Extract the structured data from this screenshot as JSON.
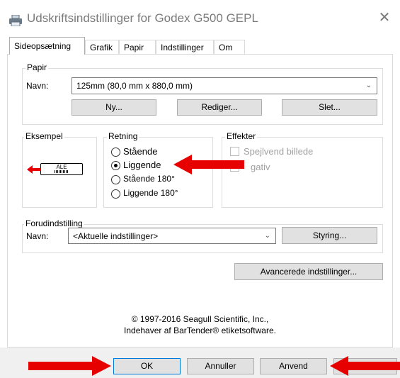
{
  "window": {
    "title": "Udskriftsindstillinger for Godex G500 GEPL",
    "close_symbol": "✕",
    "icon": "printer-icon"
  },
  "tabs": [
    {
      "label": "Sideopsætning",
      "active": true
    },
    {
      "label": "Grafik",
      "active": false
    },
    {
      "label": "Papir",
      "active": false
    },
    {
      "label": "Indstillinger",
      "active": false
    },
    {
      "label": "Om",
      "active": false
    }
  ],
  "papir": {
    "legend": "Papir",
    "name_label": "Navn:",
    "name_value": "125mm (80,0 mm x 880,0 mm)",
    "buttons": {
      "new": "Ny...",
      "edit": "Rediger...",
      "delete": "Slet..."
    }
  },
  "eksempel": {
    "legend": "Eksempel",
    "preview_text": "ALE"
  },
  "retning": {
    "legend": "Retning",
    "options": [
      {
        "label": "Stående",
        "selected": false
      },
      {
        "label": "Liggende",
        "selected": true
      },
      {
        "label": "Stående 180°",
        "selected": false
      },
      {
        "label": "Liggende 180°",
        "selected": false
      }
    ]
  },
  "effekter": {
    "legend": "Effekter",
    "options": [
      {
        "label": "Spejlvend billede",
        "checked": false,
        "enabled": false
      },
      {
        "label": "Negativ",
        "checked": false,
        "enabled": false
      }
    ],
    "visible_negativ_text": "gativ"
  },
  "forudindstilling": {
    "legend": "Forudindstilling",
    "name_label": "Navn:",
    "name_value": "<Aktuelle indstillinger>",
    "manage_button": "Styring..."
  },
  "advanced_button": "Avancerede indstillinger...",
  "copyright": {
    "line1": "© 1997-2016 Seagull Scientific, Inc.,",
    "line2": "Indehaver af BarTender® etiketsoftware."
  },
  "footer": {
    "ok": "OK",
    "cancel": "Annuller",
    "apply": "Anvend"
  },
  "colors": {
    "annotation_arrow": "#e60000",
    "default_button_border": "#0078d7",
    "button_face": "#e1e1e1"
  }
}
